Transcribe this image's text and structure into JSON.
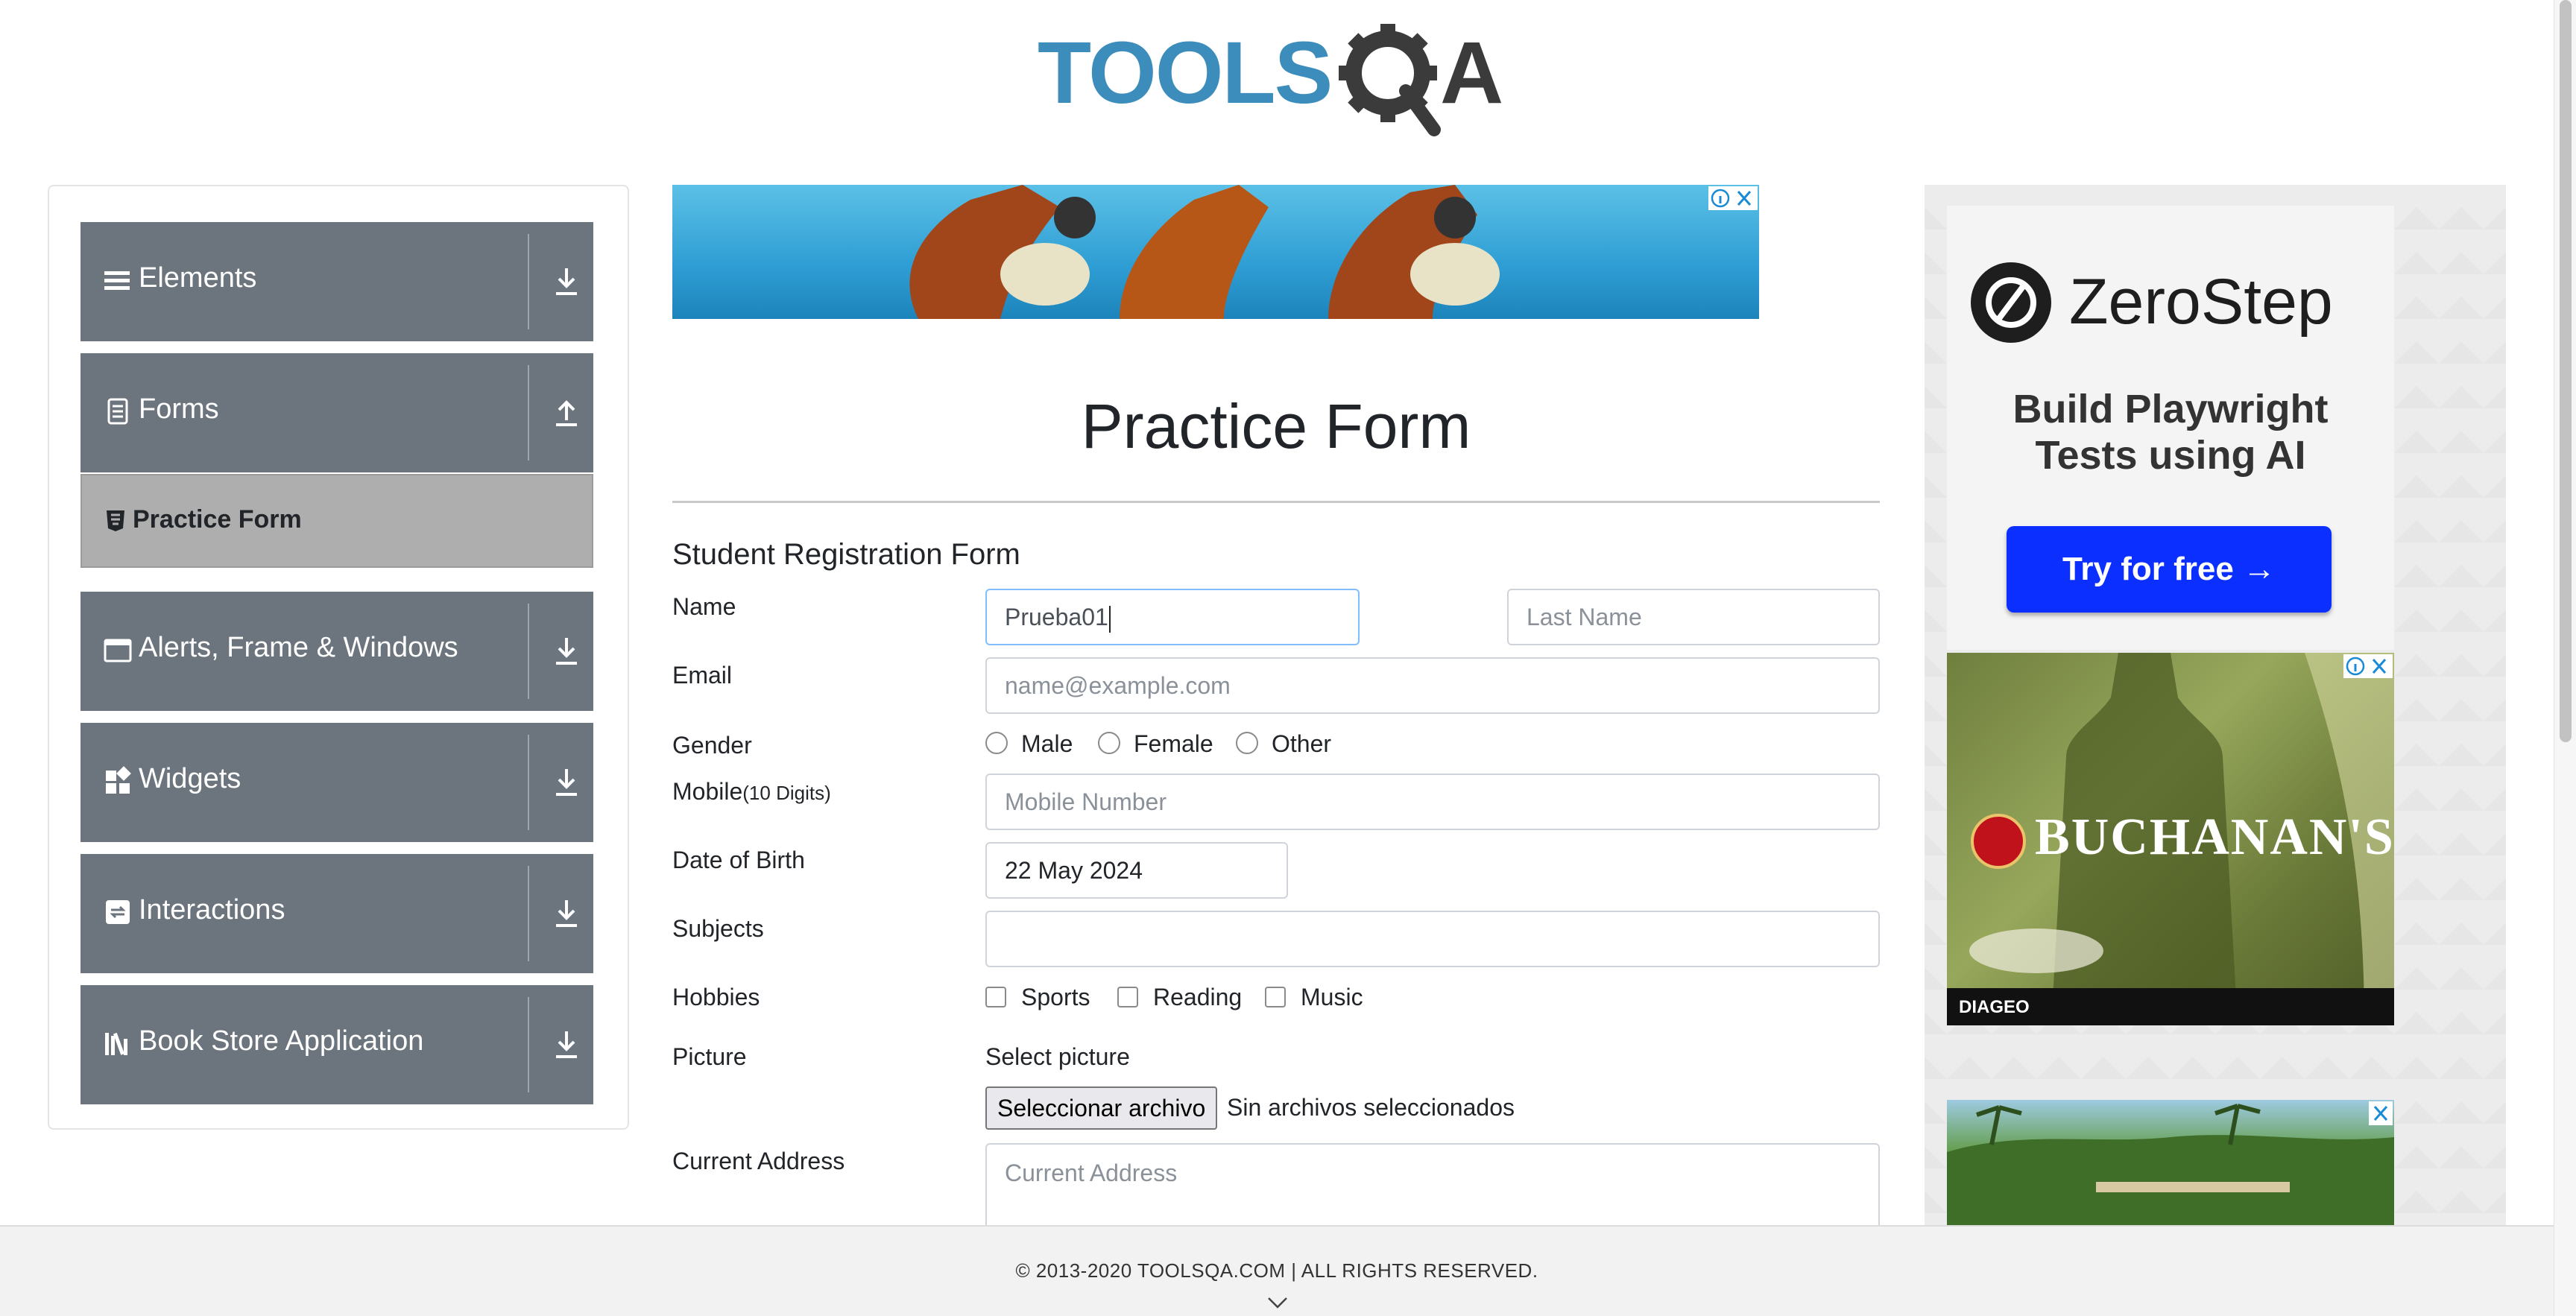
{
  "brand": {
    "logo_text_primary": "TOOLS",
    "logo_text_secondary": "QA",
    "logo_color": "#3c8dbc"
  },
  "sidebar": {
    "groups": [
      {
        "label": "Elements",
        "icon": "hamburger-icon",
        "arrow": "arrow-down-icon"
      },
      {
        "label": "Forms",
        "icon": "document-icon",
        "arrow": "arrow-up-icon"
      },
      {
        "label": "Alerts, Frame & Windows",
        "icon": "window-icon",
        "arrow": "arrow-down-icon"
      },
      {
        "label": "Widgets",
        "icon": "widgets-icon",
        "arrow": "arrow-down-icon"
      },
      {
        "label": "Interactions",
        "icon": "interactions-icon",
        "arrow": "arrow-down-icon"
      },
      {
        "label": "Book Store Application",
        "icon": "library-icon",
        "arrow": "arrow-down-icon"
      }
    ],
    "active_item": {
      "label": "Practice Form",
      "icon": "html5-icon"
    },
    "color": "#6c757d"
  },
  "main": {
    "page_title": "Practice Form",
    "form_title": "Student Registration Form",
    "name": {
      "label": "Name",
      "first_value": "Prueba01",
      "last_placeholder": "Last Name"
    },
    "email": {
      "label": "Email",
      "placeholder": "name@example.com"
    },
    "gender": {
      "label": "Gender",
      "options": [
        "Male",
        "Female",
        "Other"
      ]
    },
    "mobile": {
      "label": "Mobile",
      "label_note": "(10 Digits)",
      "placeholder": "Mobile Number"
    },
    "dob": {
      "label": "Date of Birth",
      "value": "22 May 2024"
    },
    "subjects": {
      "label": "Subjects",
      "value": ""
    },
    "hobbies": {
      "label": "Hobbies",
      "options": [
        "Sports",
        "Reading",
        "Music"
      ]
    },
    "picture": {
      "label": "Picture",
      "prompt": "Select picture",
      "button": "Seleccionar archivo",
      "status": "Sin archivos seleccionados"
    },
    "address": {
      "label": "Current Address",
      "placeholder": "Current Address"
    }
  },
  "ads": {
    "zerostep": {
      "brand": "ZeroStep",
      "tagline_line1": "Build Playwright",
      "tagline_line2": "Tests using AI",
      "cta": "Try for free →"
    },
    "buchanans": {
      "brand": "BUCHANAN'S",
      "footer_brand": "DIAGEO"
    }
  },
  "footer": {
    "copyright": "© 2013-2020 TOOLSQA.COM | ALL RIGHTS RESERVED."
  }
}
